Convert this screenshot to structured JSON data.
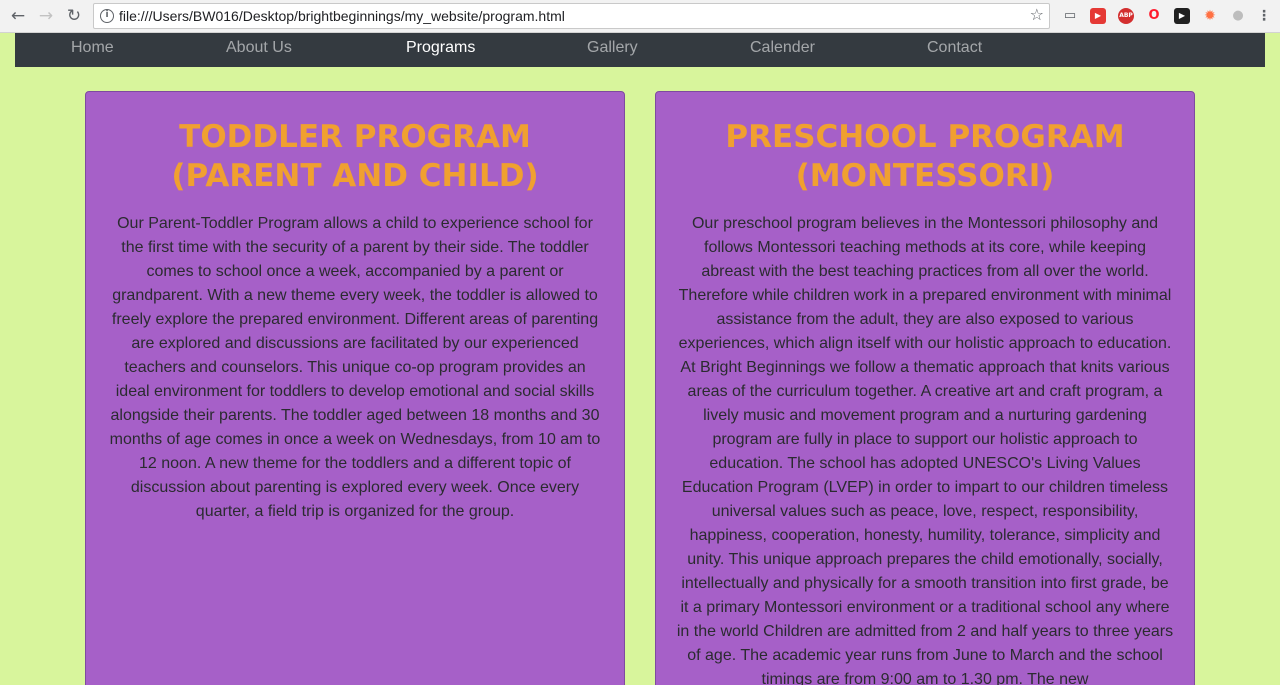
{
  "browser": {
    "url": "file:///Users/BW016/Desktop/brightbeginnings/my_website/program.html",
    "back_icon": "arrow-left",
    "forward_icon": "arrow-right",
    "reload_icon": "reload",
    "bookmark_icon": "star",
    "extensions": [
      {
        "name": "cast-icon",
        "glyph": "▭",
        "color": "#5f6368"
      },
      {
        "name": "reader-icon",
        "glyph": "▶",
        "color": "#e53935"
      },
      {
        "name": "adblock-icon",
        "glyph": "ABP",
        "color": "#d32f2f"
      },
      {
        "name": "opera-icon",
        "glyph": "O",
        "color": "#ff1b2d"
      },
      {
        "name": "youtube-icon",
        "glyph": "▶",
        "color": "#212121"
      },
      {
        "name": "fire-icon",
        "glyph": "✹",
        "color": "#ff7043"
      },
      {
        "name": "circle-icon",
        "glyph": "●",
        "color": "#bdbdbd"
      }
    ]
  },
  "nav": {
    "items": [
      "Home",
      "About Us",
      "Programs",
      "Gallery",
      "Calender",
      "Contact"
    ],
    "active": "Programs"
  },
  "cards": [
    {
      "title": "TODDLER PROGRAM (PARENT AND CHILD)",
      "text": "Our Parent-Toddler Program allows a child to experience school for the first time with the security of a parent by their side. The toddler comes to school once a week, accompanied by a parent or grandparent. With a new theme every week, the toddler is allowed to freely explore the prepared environment. Different areas of parenting are explored and discussions are facilitated by our experienced teachers and counselors. This unique co-op program provides an ideal environment for toddlers to develop emotional and social skills alongside their parents. The toddler aged between 18 months and 30 months of age comes in once a week on Wednesdays, from 10 am to 12 noon. A new theme for the toddlers and a different topic of discussion about parenting is explored every week. Once every quarter, a field trip is organized for the group."
    },
    {
      "title": "PRESCHOOL PROGRAM (MONTESSORI)",
      "text": "Our preschool program believes in the Montessori philosophy and follows Montessori teaching methods at its core, while keeping abreast with the best teaching practices from all over the world. Therefore while children work in a prepared environment with minimal assistance from the adult, they are also exposed to various experiences, which align itself with our holistic approach to education. At Bright Beginnings we follow a thematic approach that knits various areas of the curriculum together. A creative art and craft program, a lively music and movement program and a nurturing gardening program are fully in place to support our holistic approach to education. The school has adopted UNESCO's Living Values Education Program (LVEP) in order to impart to our children timeless universal values such as peace, love, respect, responsibility, happiness, cooperation, honesty, humility, tolerance, simplicity and unity. This unique approach prepares the child emotionally, socially, intellectually and physically for a smooth transition into first grade, be it a primary Montessori environment or a traditional school any where in the world Children are admitted from 2 and half years to three years of age. The academic year runs from June to March and the school timings are from 9:00 am to 1.30 pm. The new"
    }
  ],
  "colors": {
    "page_bg": "#d8f59c",
    "card_bg": "#a660c8",
    "title": "#f0a030",
    "navbar": "#343a40"
  }
}
